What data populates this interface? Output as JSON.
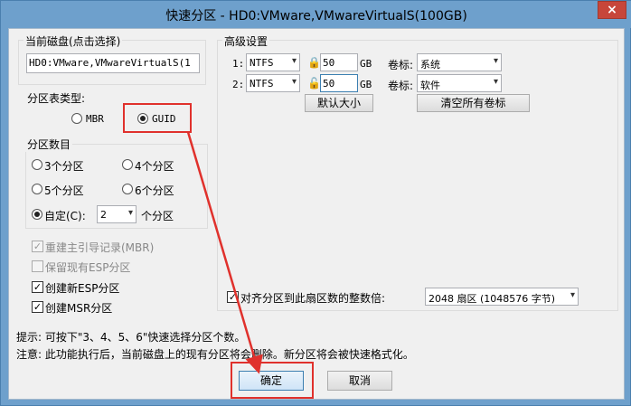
{
  "window": {
    "title": "快速分区 - HD0:VMware,VMwareVirtualS(100GB)",
    "close_icon": "×"
  },
  "current_disk": {
    "label": "当前磁盘(点击选择)",
    "value": "HD0:VMware,VMwareVirtualS(1"
  },
  "partition_table": {
    "label": "分区表类型:",
    "options": [
      {
        "label": "MBR",
        "checked": false
      },
      {
        "label": "GUID",
        "checked": true
      }
    ]
  },
  "partition_count": {
    "label": "分区数目",
    "options": [
      {
        "label": "3个分区",
        "checked": false
      },
      {
        "label": "4个分区",
        "checked": false
      },
      {
        "label": "5个分区",
        "checked": false
      },
      {
        "label": "6个分区",
        "checked": false
      }
    ],
    "custom_label": "自定(C):",
    "custom_value": "2",
    "custom_suffix": "个分区"
  },
  "checks": [
    {
      "label": "重建主引导记录(MBR)",
      "checked": true,
      "disabled": true
    },
    {
      "label": "保留现有ESP分区",
      "checked": false,
      "disabled": true
    },
    {
      "label": "创建新ESP分区",
      "checked": true,
      "disabled": false
    },
    {
      "label": "创建MSR分区",
      "checked": true,
      "disabled": false
    }
  ],
  "advanced": {
    "label": "高级设置",
    "rows": [
      {
        "index": "1:",
        "fs": "NTFS",
        "size": "50",
        "unit": "GB",
        "vol_label": "卷标:",
        "vol_value": "系统"
      },
      {
        "index": "2:",
        "fs": "NTFS",
        "size": "50",
        "unit": "GB",
        "vol_label": "卷标:",
        "vol_value": "软件"
      }
    ],
    "default_size_button": "默认大小",
    "clear_labels_button": "清空所有卷标",
    "align_label": "对齐分区到此扇区数的整数倍:",
    "align_checked": true,
    "align_value": "2048 扇区 (1048576 字节)"
  },
  "hints": {
    "line1": "提示: 可按下\"3、4、5、6\"快速选择分区个数。",
    "line2": "注意: 此功能执行后，当前磁盘上的现有分区将会删除。新分区将会被快速格式化。"
  },
  "buttons": {
    "ok": "确定",
    "cancel": "取消"
  },
  "colors": {
    "highlight": "#e0312c",
    "title_bar": "#6ea0cc"
  }
}
